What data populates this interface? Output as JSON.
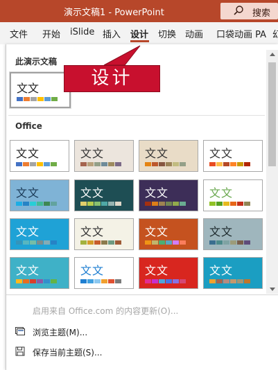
{
  "titlebar": {
    "doc_title": "演示文稿1  -  PowerPoint",
    "search_label": "搜索",
    "accent_color": "#b7472a"
  },
  "ribbon": {
    "tabs": [
      {
        "label": "文件"
      },
      {
        "label": "开始"
      },
      {
        "label": "iSlide"
      },
      {
        "label": "插入"
      },
      {
        "label": "设计",
        "active": true
      },
      {
        "label": "切换"
      },
      {
        "label": "动画"
      },
      {
        "label": "口袋动画 PA"
      },
      {
        "label": "幻"
      }
    ]
  },
  "dropdown": {
    "current_section_title": "此演示文稿",
    "current_theme": {
      "text": "文文",
      "swatches": [
        "#4472c4",
        "#ed7d31",
        "#a5a5a5",
        "#ffc000",
        "#5b9bd5",
        "#70ad47"
      ]
    },
    "office_section_title": "Office",
    "themes": [
      {
        "text": "文文",
        "bg": "#ffffff",
        "fg": "#222222",
        "swatches": [
          "#4472c4",
          "#ed7d31",
          "#a5a5a5",
          "#ffc000",
          "#5b9bd5",
          "#70ad47"
        ]
      },
      {
        "text": "文文",
        "bg": "#ece5dd",
        "fg": "#333333",
        "swatches": [
          "#a5644e",
          "#b8a17c",
          "#94a088",
          "#6f8b99",
          "#9e8b5f",
          "#7b6a87"
        ]
      },
      {
        "text": "文文",
        "bg": "#e9dcc7",
        "fg": "#333333",
        "swatches": [
          "#e48312",
          "#bd582c",
          "#865640",
          "#9b8357",
          "#c2bc80",
          "#94a088"
        ]
      },
      {
        "text": "文文",
        "bg": "#ffffff",
        "fg": "#333333",
        "swatches": [
          "#e84c22",
          "#ffbd47",
          "#b64926",
          "#ff8427",
          "#cc9900",
          "#b22600"
        ]
      },
      {
        "text": "文文",
        "bg": "#7fb3d6",
        "fg": "#1b3a57",
        "swatches": [
          "#1cade4",
          "#2683c6",
          "#27ced7",
          "#42ba97",
          "#3e8853",
          "#62a39f"
        ]
      },
      {
        "text": "文文",
        "bg": "#1e4e54",
        "fg": "#ffffff",
        "swatches": [
          "#e0ce6b",
          "#b6cb4c",
          "#89c06f",
          "#4fa8a6",
          "#95b3b0",
          "#ddd7c8"
        ]
      },
      {
        "text": "文文",
        "bg": "#3d2e58",
        "fg": "#ffffff",
        "swatches": [
          "#a53010",
          "#de7e18",
          "#9f8351",
          "#728653",
          "#92aa4c",
          "#6aac91"
        ]
      },
      {
        "text": "文文",
        "bg": "#ffffff",
        "fg": "#6aa84f",
        "swatches": [
          "#90c226",
          "#54a021",
          "#e6b91e",
          "#e76618",
          "#c42f1a",
          "#918655"
        ]
      },
      {
        "text": "文文",
        "bg": "#1fa2d6",
        "fg": "#ffffff",
        "swatches": [
          "#3494ba",
          "#58b6c0",
          "#75bda7",
          "#7a8c8e",
          "#84acb6",
          "#2683c6"
        ]
      },
      {
        "text": "文文",
        "bg": "#f4f2e6",
        "fg": "#333333",
        "swatches": [
          "#a3b23e",
          "#d49c2a",
          "#c75d2c",
          "#8c7b4c",
          "#6e9a81",
          "#9d5a36"
        ]
      },
      {
        "text": "文文",
        "bg": "#c5521f",
        "fg": "#ffffff",
        "swatches": [
          "#f09415",
          "#c1b56b",
          "#4baf73",
          "#5aa6c0",
          "#d17df9",
          "#fa7e5c"
        ]
      },
      {
        "text": "文文",
        "bg": "#9fb6bd",
        "fg": "#1f2b2e",
        "swatches": [
          "#3b6e8f",
          "#4c8a8a",
          "#7fa3a3",
          "#9c9c7a",
          "#7a5f4c",
          "#5f4c7a"
        ]
      },
      {
        "text": "文文",
        "bg": "#3fb1c7",
        "fg": "#ffffff",
        "swatches": [
          "#ffb91d",
          "#e86c1f",
          "#d93e2a",
          "#8c59a6",
          "#338fcc",
          "#63b346"
        ]
      },
      {
        "text": "文文",
        "bg": "#ffffff",
        "fg": "#1f7fd1",
        "swatches": [
          "#1f7fd1",
          "#3fa0e0",
          "#8cc8f0",
          "#f0a030",
          "#e05030",
          "#7a7a7a"
        ]
      },
      {
        "text": "文文",
        "bg": "#d8261f",
        "fg": "#ffffff",
        "swatches": [
          "#e32d91",
          "#c830cc",
          "#4ea6dc",
          "#4775e7",
          "#8971e1",
          "#d54773"
        ]
      },
      {
        "text": "文文",
        "bg": "#1b9ec2",
        "fg": "#ffffff",
        "swatches": [
          "#f0a22e",
          "#a5644e",
          "#b58b80",
          "#c3986d",
          "#a19574",
          "#c17529"
        ]
      }
    ]
  },
  "callout": {
    "text": "设计",
    "color": "#c8102e"
  },
  "footer": {
    "update_label": "启用来自 Office.com 的内容更新(O)...",
    "browse_label": "浏览主题(M)...",
    "save_label": "保存当前主题(S)..."
  }
}
